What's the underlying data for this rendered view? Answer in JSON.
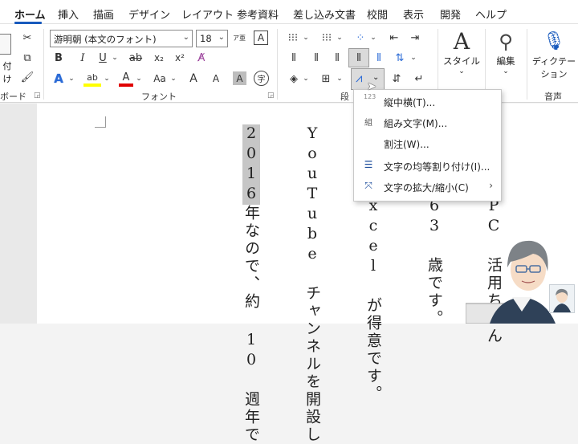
{
  "tabs": [
    "ホーム",
    "挿入",
    "描画",
    "デザイン",
    "レイアウト",
    "参考資料",
    "差し込み文書",
    "校閲",
    "表示",
    "開発",
    "ヘルプ"
  ],
  "active_tab": "ホーム",
  "ribbon": {
    "clipboard_paste_fragment": "付け",
    "clipboard_label_fragment": "ボード",
    "font_name": "游明朝 (本文のフォント)",
    "font_size": "18",
    "font_group_label": "フォント",
    "paragraph_group_label_fragment": "段",
    "styles_label": "スタイル",
    "editing_label": "編集",
    "dictation_label_1": "ディクテー",
    "dictation_label_2": "ション",
    "voice_group_label": "音声",
    "bold": "B",
    "italic": "I",
    "underline": "U",
    "strike": "ab",
    "subscript": "x₂",
    "superscript": "x²",
    "text_effect": "A",
    "highlight": "ab",
    "font_color": "A",
    "change_case": "Aa",
    "grow_font": "A",
    "shrink_font": "A",
    "char_shading": "A",
    "enclose_char": "字",
    "phonetic": "ア亜",
    "char_border": "A"
  },
  "menu": {
    "items": [
      {
        "label": "縦中横(T)...",
        "icon": "tate-chu-yoko-icon"
      },
      {
        "label": "組み文字(M)...",
        "icon": "kumimoji-icon"
      },
      {
        "label": "割注(W)...",
        "icon": ""
      },
      {
        "label": "文字の均等割り付け(I)...",
        "icon": "distribute-icon"
      },
      {
        "label": "文字の拡大/縮小(C)",
        "icon": "scale-icon",
        "submenu": true
      }
    ],
    "hint_number": "123"
  },
  "document": {
    "col1_highlight": "2016",
    "col1_rest": "年なので、約 10 週年で",
    "col2": "YouTube チャンネルを開設し",
    "col3": "xcel が得意です。",
    "col4": "63 歳です。",
    "col5": "PC 活用ちゃん"
  },
  "colors": {
    "accent": "#185abd",
    "highlight": "#ffff00",
    "font_red": "#e00000"
  }
}
